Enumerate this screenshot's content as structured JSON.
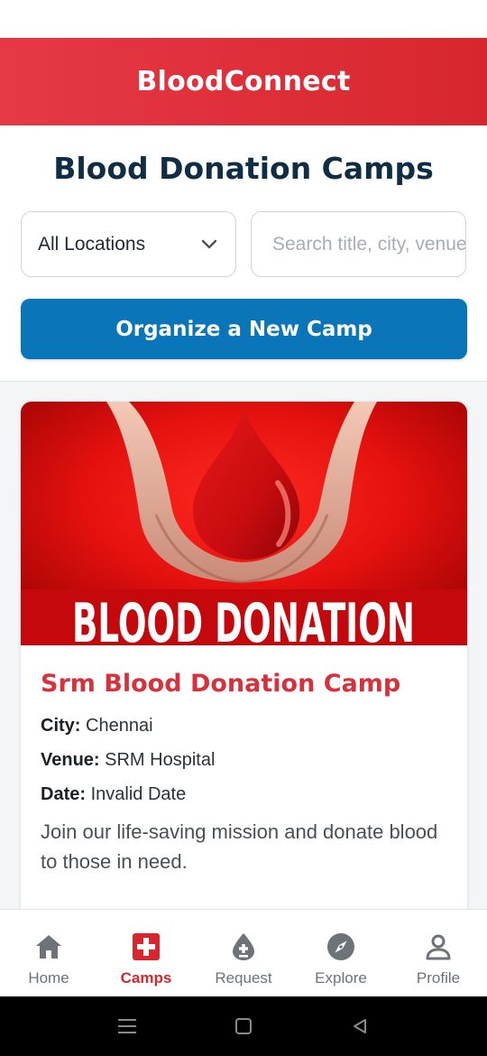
{
  "header": {
    "app_title": "BloodConnect"
  },
  "page": {
    "title": "Blood Donation Camps"
  },
  "filters": {
    "location_selected": "All Locations",
    "search_placeholder": "Search title, city, venue"
  },
  "actions": {
    "organize_label": "Organize a New Camp"
  },
  "camps": [
    {
      "image_banner_text": "BLOOD DONATION",
      "title": "Srm Blood Donation Camp",
      "city_label": "City:",
      "city": "Chennai",
      "venue_label": "Venue:",
      "venue": "SRM Hospital",
      "date_label": "Date:",
      "date": "Invalid Date",
      "description": "Join our life-saving mission and donate blood to those in need."
    }
  ],
  "nav": {
    "items": [
      {
        "label": "Home",
        "icon": "home-icon",
        "active": false
      },
      {
        "label": "Camps",
        "icon": "medical-cross-icon",
        "active": true
      },
      {
        "label": "Request",
        "icon": "blood-drop-plus-icon",
        "active": false
      },
      {
        "label": "Explore",
        "icon": "compass-icon",
        "active": false
      },
      {
        "label": "Profile",
        "icon": "user-icon",
        "active": false
      }
    ]
  },
  "colors": {
    "brand_red": "#d7262d",
    "title_navy": "#0f2d44",
    "primary_blue": "#0a75b8",
    "camp_title_red": "#d7323c"
  }
}
